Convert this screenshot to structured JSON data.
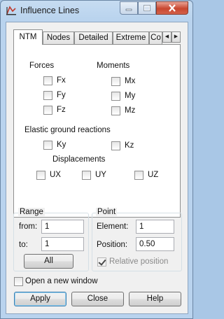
{
  "window": {
    "title": "Influence Lines",
    "icons": {
      "app": "influence-lines-app-icon",
      "minimize": "minimize-icon",
      "maximize": "maximize-icon",
      "close": "close-icon"
    },
    "close_color": "#c8472f"
  },
  "tabs": [
    {
      "label": "NTM",
      "active": true
    },
    {
      "label": "Nodes"
    },
    {
      "label": "Detailed"
    },
    {
      "label": "Extreme"
    },
    {
      "label": "Co"
    }
  ],
  "tab_scroll": {
    "left_icon": "arrow-left-icon",
    "right_icon": "arrow-right-icon"
  },
  "ntm": {
    "forces_title": "Forces",
    "forces": [
      {
        "label": "Fx",
        "checked": false
      },
      {
        "label": "Fy",
        "checked": false
      },
      {
        "label": "Fz",
        "checked": false
      }
    ],
    "moments_title": "Moments",
    "moments": [
      {
        "label": "Mx",
        "checked": false
      },
      {
        "label": "My",
        "checked": false
      },
      {
        "label": "Mz",
        "checked": false
      }
    ],
    "elastic_title": "Elastic ground reactions",
    "elastic": [
      {
        "label": "Ky",
        "checked": false
      },
      {
        "label": "Kz",
        "checked": false
      }
    ],
    "displacements_title": "Displacements",
    "displacements": [
      {
        "label": "UX",
        "checked": false
      },
      {
        "label": "UY",
        "checked": false
      },
      {
        "label": "UZ",
        "checked": false
      }
    ]
  },
  "range": {
    "title": "Range",
    "from_label": "from:",
    "from_value": "1",
    "to_label": "to:",
    "to_value": "1",
    "all_button": "All"
  },
  "point": {
    "title": "Point",
    "element_label": "Element:",
    "element_value": "1",
    "position_label": "Position:",
    "position_value": "0.50",
    "relative_label": "Relative position",
    "relative_checked": true,
    "relative_enabled": false
  },
  "new_window": {
    "label": "Open a new window",
    "checked": false
  },
  "buttons": {
    "apply": "Apply",
    "close": "Close",
    "help": "Help"
  }
}
